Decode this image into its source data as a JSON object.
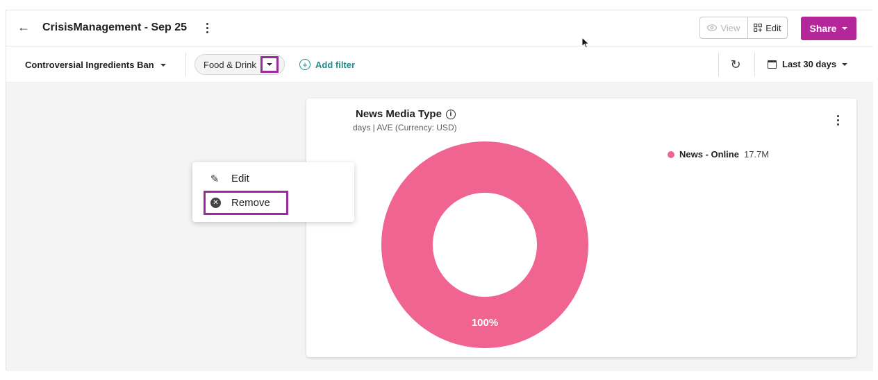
{
  "header": {
    "title": "CrisisManagement - Sep 25",
    "view_label": "View",
    "edit_label": "Edit",
    "share_label": "Share"
  },
  "filterbar": {
    "topic": "Controversial Ingredients Ban",
    "chip_label": "Food & Drink",
    "add_filter_label": "Add filter",
    "date_range": "Last 30 days"
  },
  "menu": {
    "items": [
      {
        "label": "Edit",
        "icon": "pencil-icon"
      },
      {
        "label": "Remove",
        "icon": "x-circle-icon"
      }
    ]
  },
  "card": {
    "title": "News Media Type",
    "subtitle": "days | AVE (Currency: USD)"
  },
  "chart_data": {
    "type": "pie",
    "series": [
      {
        "name": "News - Online",
        "value_label": "17.7M",
        "percent": 100,
        "color": "#f06492"
      }
    ],
    "center_label": "100%"
  },
  "colors": {
    "accent": "#b4279a",
    "highlight_box": "#9b2aa0",
    "link": "#1b8f8a",
    "slice": "#f06492"
  }
}
